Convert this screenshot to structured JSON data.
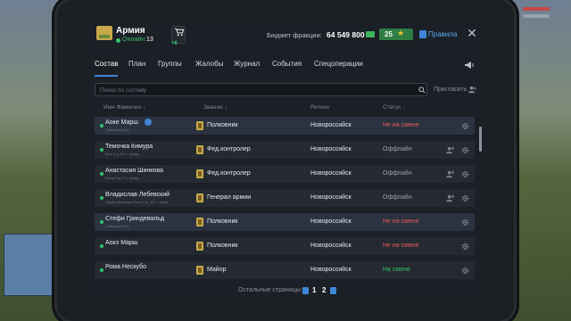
{
  "header": {
    "faction_name": "Армия",
    "online_label": "Онлайн:",
    "online_count": "13",
    "cart_badge": "+6",
    "budget_label": "Бюджет фракции:",
    "budget_value": "64 549 800",
    "stars_value": "25",
    "rules_label": "Правила"
  },
  "tabs": [
    "Состав",
    "План",
    "Группы",
    "Жалобы",
    "Журнал",
    "События",
    "Спецоперации"
  ],
  "search": {
    "placeholder": "Поиск по составу",
    "invite_label": "Пригласить"
  },
  "table": {
    "columns": [
      "Имя Фамилия ↓",
      "Звание ↓",
      "Регион",
      "Статус ↓"
    ],
    "rows": [
      {
        "name": "Аоке Марш",
        "sub": "(Заместитель)",
        "rank": "Полковник",
        "region": "Новороссийск",
        "status": "Не на смене",
        "status_type": "off_shift"
      },
      {
        "name": "Темочка Кимура",
        "sub": "Был 2 д. 20 ч. назад",
        "rank": "Фед.контролер",
        "region": "Новороссийск",
        "status": "Оффлайн",
        "status_type": "offline"
      },
      {
        "name": "Анастасия Шинкова",
        "sub": "Была 2 д. 7 ч. назад",
        "rank": "Фед.контролер",
        "region": "Новороссийск",
        "status": "Оффлайн",
        "status_type": "offline"
      },
      {
        "name": "Владислав Лебевский",
        "sub": "(Лидер фракции) Был 2 д. 20 ч. назад",
        "rank": "Генерал армии",
        "region": "Новороссийск",
        "status": "Оффлайн",
        "status_type": "offline"
      },
      {
        "name": "Стефи Гриндевальд",
        "sub": "(Заместитель)",
        "rank": "Полковник",
        "region": "Новороссийск",
        "status": "Не на смене",
        "status_type": "off_shift"
      },
      {
        "name": "Аокэ Марш",
        "sub": "",
        "rank": "Полковник",
        "region": "Новороссийск",
        "status": "Не на смене",
        "status_type": "off_shift"
      },
      {
        "name": "Рома Нескубо",
        "sub": "",
        "rank": "Майор",
        "region": "Новороссийск",
        "status": "На смене",
        "status_type": "on_shift"
      }
    ]
  },
  "pager": {
    "label": "Остальные страницы:",
    "pages": [
      "1",
      "2"
    ]
  },
  "colors": {
    "accent": "#3f86d6",
    "online": "#33c26b",
    "off_shift": "#e85a5a",
    "offline": "#9aa3ad"
  }
}
